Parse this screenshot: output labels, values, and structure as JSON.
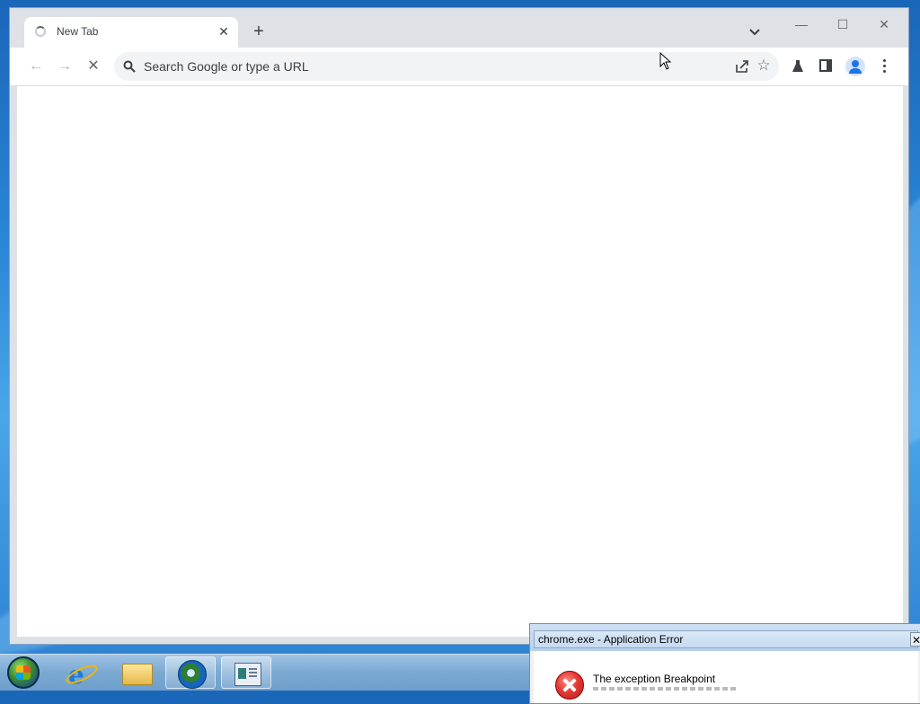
{
  "browser": {
    "tab": {
      "title": "New Tab",
      "close_glyph": "✕"
    },
    "new_tab_glyph": "+",
    "window_controls": {
      "minimize": "—",
      "maximize": "☐",
      "close": "✕"
    },
    "toolbar": {
      "back_glyph": "←",
      "forward_glyph": "→",
      "stop_glyph": "✕",
      "omnibox_placeholder": "Search Google or type a URL",
      "star_glyph": "☆"
    },
    "icons": [
      "tab-loading-spinner-icon",
      "tab-search-icon",
      "search-icon",
      "share-icon",
      "bookmark-star-icon",
      "chrome-labs-icon",
      "side-panel-icon",
      "profile-avatar-icon",
      "kebab-menu-icon"
    ]
  },
  "taskbar": {
    "items": [
      "start-orb",
      "internet-explorer",
      "windows-explorer",
      "chrome",
      "app-window"
    ]
  },
  "dialog": {
    "title": "chrome.exe - Application Error",
    "close_glyph": "✕",
    "message": "The exception Breakpoint"
  },
  "colors": {
    "accent": "#1a73e8",
    "error": "#e53935",
    "taskbar": "#7aa9d3"
  }
}
